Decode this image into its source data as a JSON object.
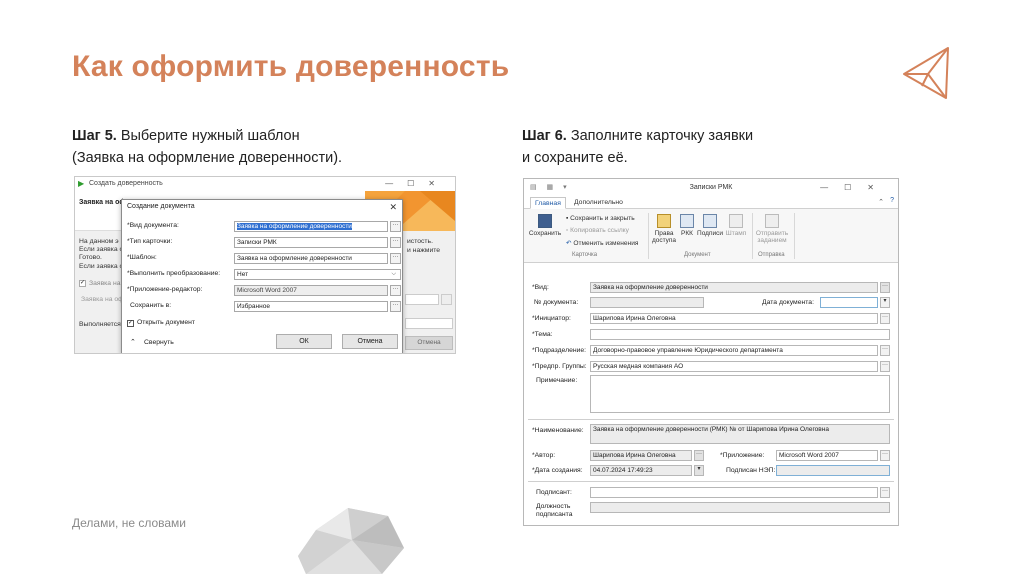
{
  "title": "Как оформить доверенность",
  "footer": "Делами, не словами",
  "step5": {
    "label": "Шаг 5.",
    "line1": " Выберите нужный шаблон",
    "line2": "(Заявка на оформление доверенности)."
  },
  "step6": {
    "label": "Шаг 6.",
    "line1": " Заполните карточку заявки",
    "line2": "и сохраните её."
  },
  "colors": {
    "accent": "#d4825a",
    "selection": "#2f6fd1"
  },
  "left_screenshot": {
    "bg_window_title": "Создать доверенность",
    "bg_header": "Заявка на оф",
    "bg_text1": "На данном э",
    "bg_text1b": "Если заявка с",
    "bg_text1c": "Готово.",
    "bg_text1d": "Если заявка с",
    "bg_text_right1": "истость.",
    "bg_text_right2": "и нажмите",
    "bg_check_label": "Заявка на",
    "bg_field_label": "Заявка на оф",
    "bg_executing": "Выполняется",
    "bg_cancel": "Отмена",
    "dialog": {
      "title": "Создание документа",
      "fields": [
        {
          "label": "*Вид документа:",
          "value": "Заявка на оформление доверенности"
        },
        {
          "label": "*Тип карточки:",
          "value": "Записки РМК"
        },
        {
          "label": "*Шаблон:",
          "value": "Заявка на оформление доверенности"
        },
        {
          "label": "*Выполнить преобразование:",
          "value": "Нет"
        },
        {
          "label": "*Приложение-редактор:",
          "value": "Microsoft Word 2007"
        },
        {
          "label": "Сохранить в:",
          "value": "Избранное"
        }
      ],
      "open_doc": "Открыть документ",
      "collapse": "Свернуть",
      "ok": "ОК",
      "cancel": "Отмена"
    }
  },
  "right_screenshot": {
    "window_title": "Записки РМК",
    "tabs": [
      "Главная",
      "Дополнительно"
    ],
    "ribbon": {
      "save": "Сохранить",
      "save_close": "Сохранить и закрыть",
      "copy_link": "Копировать ссылку",
      "cancel_changes": "Отменить изменения",
      "group_card": "Карточка",
      "rights": "Права",
      "rights2": "доступа",
      "rkk": "РКК",
      "signatures": "Подписи",
      "stamp": "Штамп",
      "group_document": "Документ",
      "send": "Отправить",
      "send2": "заданием",
      "group_send": "Отправка"
    },
    "form": {
      "vid_label": "*Вид:",
      "vid_value": "Заявка на оформление доверенности",
      "docnum_label": "№ документа:",
      "docdate_label": "Дата документа:",
      "initiator_label": "*Инициатор:",
      "initiator_value": "Шарипова Ирина Олеговна",
      "theme_label": "*Тема:",
      "dept_label": "*Подразделение:",
      "dept_value": "Договорно-правовое управление Юридического департамента",
      "group_label": "*Предпр. Группы:",
      "group_value": "Русская медная компания АО",
      "note_label": "Примечание:",
      "name_label": "*Наименование:",
      "name_value": "Заявка на оформление доверенности (РМК) №  от  Шарипова Ирина Олеговна",
      "author_label": "*Автор:",
      "author_value": "Шарипова Ирина Олеговна",
      "app_label": "*Приложение:",
      "app_value": "Microsoft Word 2007",
      "created_label": "*Дата создания:",
      "created_value": "04.07.2024 17:49:23",
      "signed_label": "Подписан НЭП:",
      "signer_label": "Подписант:",
      "position_label1": "Должность",
      "position_label2": "подписанта"
    }
  }
}
